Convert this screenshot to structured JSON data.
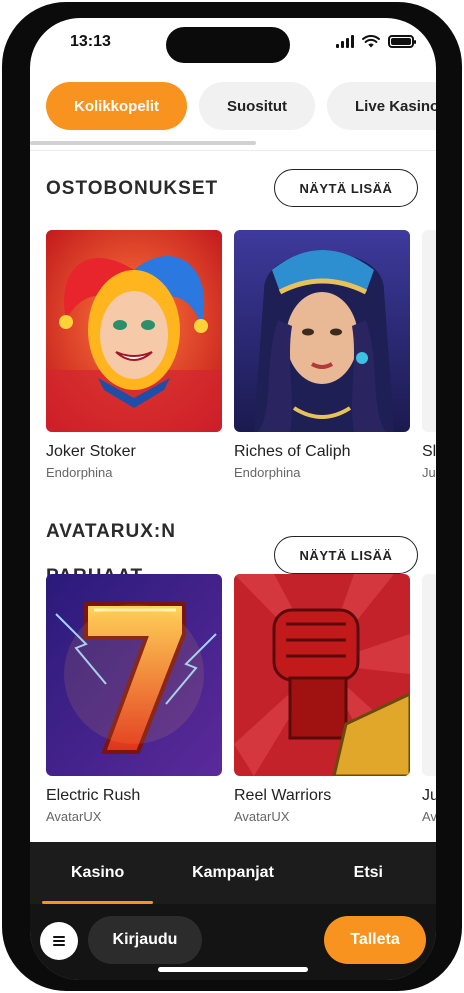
{
  "status_bar": {
    "time": "13:13"
  },
  "tabs": [
    {
      "label": "Kolikkopelit",
      "active": true
    },
    {
      "label": "Suositut",
      "active": false
    },
    {
      "label": "Live Kasino",
      "active": false
    }
  ],
  "sections": [
    {
      "title": "OSTOBONUKSET",
      "more_label": "NÄYTÄ LISÄÄ",
      "games": [
        {
          "title": "Joker Stoker",
          "provider": "Endorphina"
        },
        {
          "title": "Riches of Caliph",
          "provider": "Endorphina"
        },
        {
          "title": "Sl",
          "provider": "Ju"
        }
      ]
    },
    {
      "title_line1": "AVATARUX:N",
      "title_line2": "PARHAAT",
      "more_label": "NÄYTÄ LISÄÄ",
      "games": [
        {
          "title": "Electric Rush",
          "provider": "AvatarUX"
        },
        {
          "title": "Reel Warriors",
          "provider": "AvatarUX"
        },
        {
          "title": "Ju",
          "provider": "Av"
        }
      ]
    }
  ],
  "bottom_nav": {
    "items": [
      {
        "label": "Kasino",
        "active": true
      },
      {
        "label": "Kampanjat",
        "active": false
      },
      {
        "label": "Etsi",
        "active": false
      }
    ],
    "login_label": "Kirjaudu",
    "deposit_label": "Talleta"
  },
  "colors": {
    "accent": "#f7931e",
    "nav_bg": "#1c1c1c"
  }
}
